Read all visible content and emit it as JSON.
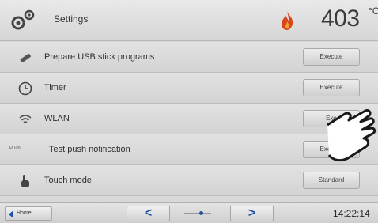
{
  "header": {
    "title": "Settings",
    "temperature": "403",
    "unit": "°C"
  },
  "rows": [
    {
      "label": "Prepare USB stick programs",
      "button": "Execute",
      "icon": "usb-stick-icon"
    },
    {
      "label": "Timer",
      "button": "Execute",
      "icon": "clock-icon"
    },
    {
      "label": "WLAN",
      "button": "Exe",
      "icon": "wifi-icon"
    },
    {
      "label": "Test push notification",
      "button": "Execute",
      "icon": "push-notification-icon",
      "icon_text": "Push"
    },
    {
      "label": "Touch mode",
      "button": "Standard",
      "icon": "touch-hand-icon"
    }
  ],
  "footer": {
    "home_label": "Home",
    "prev_symbol": "<",
    "next_symbol": ">",
    "time": "14:22:14"
  },
  "colors": {
    "accent": "#1d4fa8",
    "flame": "#d9461a"
  }
}
